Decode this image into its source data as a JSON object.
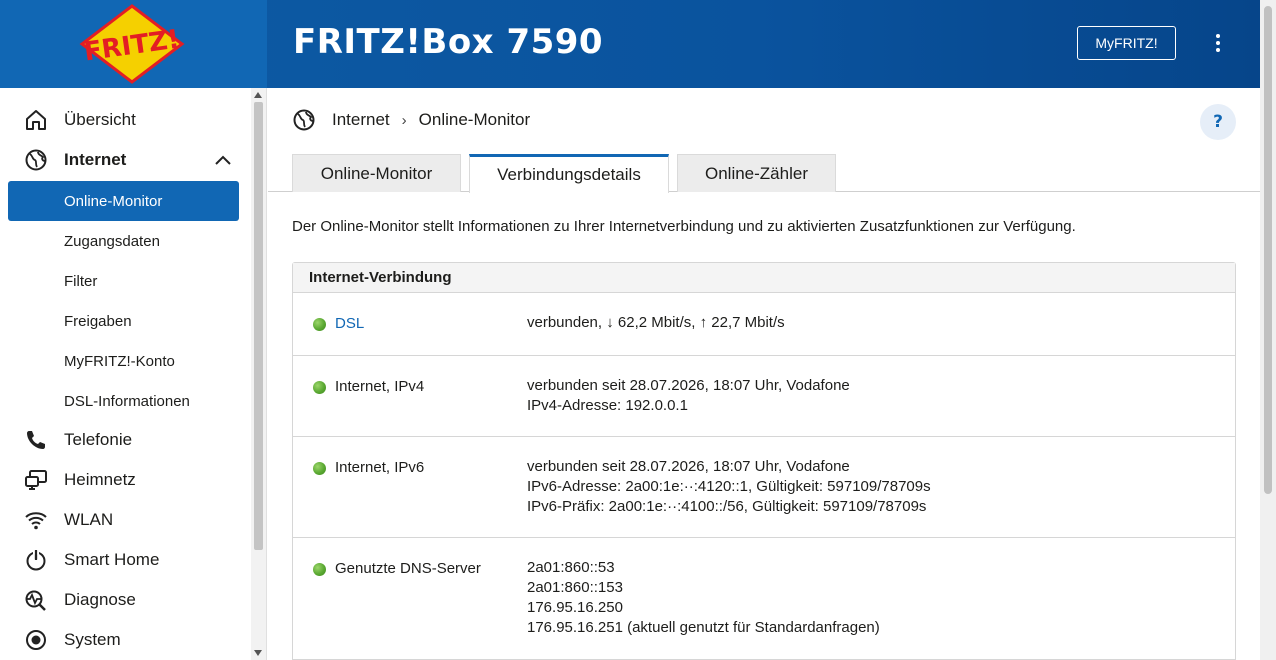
{
  "header": {
    "logo_text": "FRITZ!",
    "title": "FRITZ!Box 7590",
    "myfritz_label": "MyFRITZ!",
    "menu_icon": "kebab-menu-icon"
  },
  "sidebar": {
    "items": [
      {
        "label": "Übersicht",
        "icon": "home-icon"
      },
      {
        "label": "Internet",
        "icon": "globe-icon",
        "expanded": true
      },
      {
        "label": "Telefonie",
        "icon": "phone-icon"
      },
      {
        "label": "Heimnetz",
        "icon": "network-icon"
      },
      {
        "label": "WLAN",
        "icon": "wifi-icon"
      },
      {
        "label": "Smart Home",
        "icon": "smart-home-icon"
      },
      {
        "label": "Diagnose",
        "icon": "diagnose-icon"
      },
      {
        "label": "System",
        "icon": "system-icon"
      }
    ],
    "sub_items": [
      {
        "label": "Online-Monitor",
        "active": true
      },
      {
        "label": "Zugangsdaten"
      },
      {
        "label": "Filter"
      },
      {
        "label": "Freigaben"
      },
      {
        "label": "MyFRITZ!-Konto"
      },
      {
        "label": "DSL-Informationen"
      }
    ]
  },
  "breadcrumb": {
    "root": "Internet",
    "current": "Online-Monitor"
  },
  "help_label": "?",
  "tabs": [
    {
      "label": "Online-Monitor"
    },
    {
      "label": "Verbindungsdetails",
      "active": true
    },
    {
      "label": "Online-Zähler"
    }
  ],
  "intro": "Der Online-Monitor stellt Informationen zu Ihrer Internetverbindung und zu aktivierten Zusatzfunktionen zur Verfügung.",
  "panel": {
    "title": "Internet-Verbindung",
    "rows": [
      {
        "name": "DSL",
        "lines": [
          "verbunden, ↓ 62,2 Mbit/s, ↑ 22,7 Mbit/s"
        ],
        "status_color": "#5aa832"
      },
      {
        "name": "Internet, IPv4",
        "lines": [
          "verbunden seit 28.07.2026, 18:07 Uhr, Vodafone",
          "IPv4-Adresse: 192.0.0.1"
        ],
        "status_color": "#5aa832"
      },
      {
        "name": "Internet, IPv6",
        "lines": [
          "verbunden seit 28.07.2026, 18:07 Uhr, Vodafone",
          "IPv6-Adresse: 2a00:1e:··:4120::1, Gültigkeit: 597109/78709s",
          "IPv6-Präfix: 2a00:1e:··:4100::/56, Gültigkeit: 597109/78709s"
        ],
        "status_color": "#5aa832"
      },
      {
        "name": "Genutzte DNS-Server",
        "lines": [
          "2a01:860::53",
          "2a01:860::153",
          "176.95.16.250",
          "176.95.16.251 (aktuell genutzt für Standardanfragen)"
        ],
        "status_color": "#5aa832"
      }
    ]
  },
  "colors": {
    "brand_blue": "#1167b4",
    "status_green": "#5aa832"
  }
}
